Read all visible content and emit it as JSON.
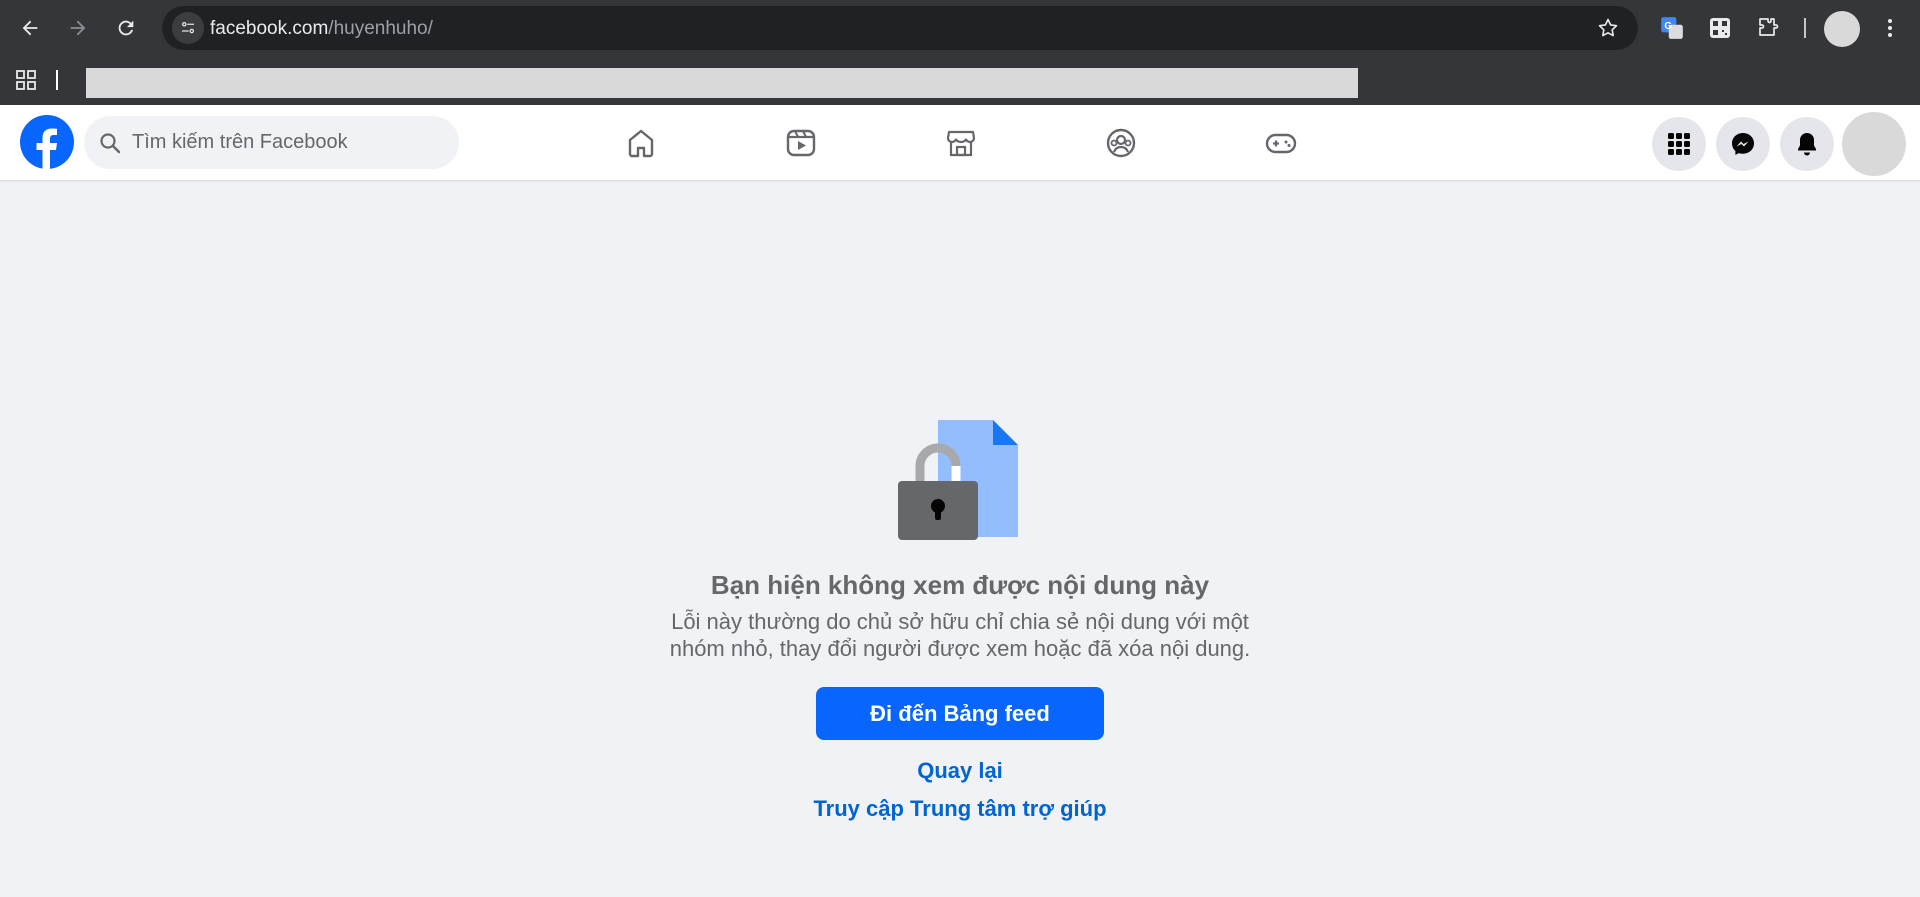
{
  "browser": {
    "url_host": "facebook.com",
    "url_path": "/huyenhuho/"
  },
  "facebook": {
    "search_placeholder": "Tìm kiếm trên Facebook",
    "nav_tabs": [
      "home-icon",
      "video-icon",
      "marketplace-icon",
      "groups-icon",
      "gaming-icon"
    ],
    "right_buttons": [
      "menu-grid-icon",
      "messenger-icon",
      "notifications-bell-icon"
    ],
    "brand_color": "#0866ff"
  },
  "content": {
    "title": "Bạn hiện không xem được nội dung này",
    "description_line1": "Lỗi này thường do chủ sở hữu chỉ chia sẻ nội dung với một",
    "description_line2": "nhóm nhỏ, thay đổi người được xem hoặc đã xóa nội dung.",
    "primary_button": "Đi đến Bảng feed",
    "back_link": "Quay lại",
    "help_link": "Truy cập Trung tâm trợ giúp",
    "link_color": "#0064d1"
  }
}
